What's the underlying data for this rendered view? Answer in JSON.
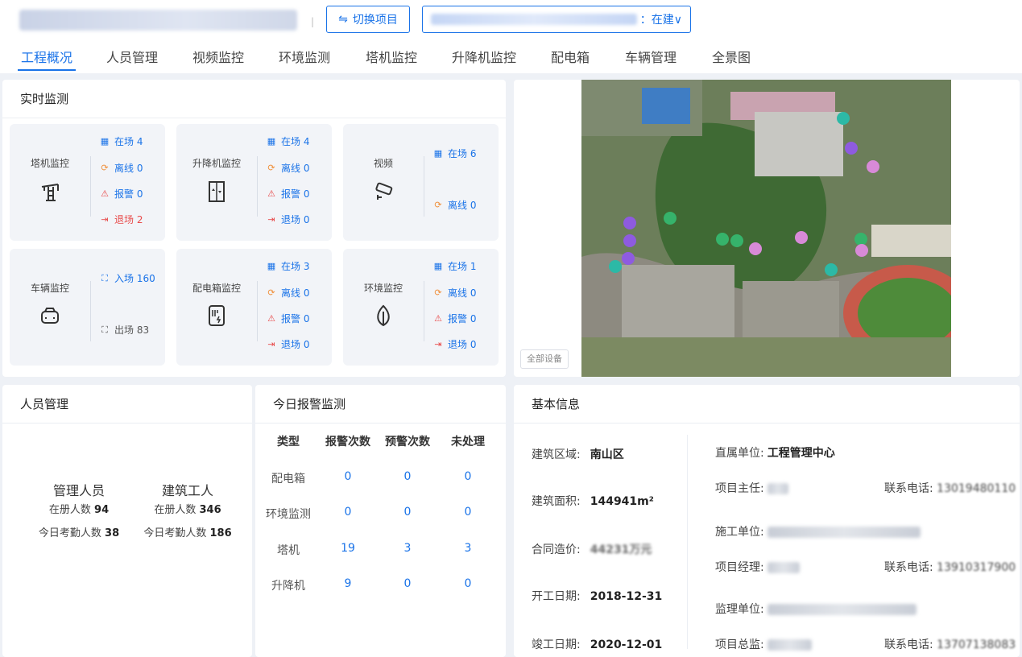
{
  "header": {
    "switch_label": "切换项目",
    "switch_icon": "⇋",
    "project_status": "：在建∨"
  },
  "tabs": [
    "工程概况",
    "人员管理",
    "视频监控",
    "环境监测",
    "塔机监控",
    "升降机监控",
    "配电箱",
    "车辆管理",
    "全景图"
  ],
  "realtime": {
    "title": "实时监测",
    "tower": {
      "name": "塔机监控",
      "onsite": "在场 4",
      "offline": "离线 0",
      "alarm": "报警 0",
      "exit": "退场 2"
    },
    "elevator": {
      "name": "升降机监控",
      "onsite": "在场 4",
      "offline": "离线 0",
      "alarm": "报警 0",
      "exit": "退场 0"
    },
    "video": {
      "name": "视频",
      "onsite": "在场 6",
      "offline": "离线 0"
    },
    "vehicle": {
      "name": "车辆监控",
      "enter": "入场 160",
      "exit": "出场 83"
    },
    "power": {
      "name": "配电箱监控",
      "onsite": "在场 3",
      "offline": "离线 0",
      "alarm": "报警 0",
      "exit": "退场 0"
    },
    "env": {
      "name": "环境监控",
      "onsite": "在场 1",
      "offline": "离线 0",
      "alarm": "报警 0",
      "exit": "退场 0"
    }
  },
  "map": {
    "all_devices": "全部设备"
  },
  "personnel": {
    "title": "人员管理",
    "managers": {
      "label": "管理人员",
      "registered_label": "在册人数",
      "registered": "94",
      "today_label": "今日考勤人数",
      "today": "38"
    },
    "workers": {
      "label": "建筑工人",
      "registered_label": "在册人数",
      "registered": "346",
      "today_label": "今日考勤人数",
      "today": "186"
    }
  },
  "alarms": {
    "title": "今日报警监测",
    "headers": [
      "类型",
      "报警次数",
      "预警次数",
      "未处理"
    ],
    "rows": [
      {
        "type": "配电箱",
        "alarm": "0",
        "warn": "0",
        "pending": "0"
      },
      {
        "type": "环境监测",
        "alarm": "0",
        "warn": "0",
        "pending": "0"
      },
      {
        "type": "塔机",
        "alarm": "19",
        "warn": "3",
        "pending": "3"
      },
      {
        "type": "升降机",
        "alarm": "9",
        "warn": "0",
        "pending": "0"
      }
    ]
  },
  "basic": {
    "title": "基本信息",
    "area_label": "建筑区域:",
    "area": "南山区",
    "size_label": "建筑面积:",
    "size": "144941m²",
    "cost_label": "合同造价:",
    "cost_visible": "44231万元",
    "start_label": "开工日期:",
    "start": "2018-12-31",
    "end_label": "竣工日期:",
    "end": "2020-12-01",
    "affiliate_label": "直属单位:",
    "affiliate": "工程管理中心",
    "director_label": "项目主任:",
    "phone_label": "联系电话:",
    "phone1_visible": "13019480110",
    "builder_label": "施工单位:",
    "manager_label": "项目经理:",
    "phone2_visible": "13910317900",
    "supervisor_label": "监理单位:",
    "chief_label": "项目总监:",
    "phone3_visible": "13707138083"
  }
}
